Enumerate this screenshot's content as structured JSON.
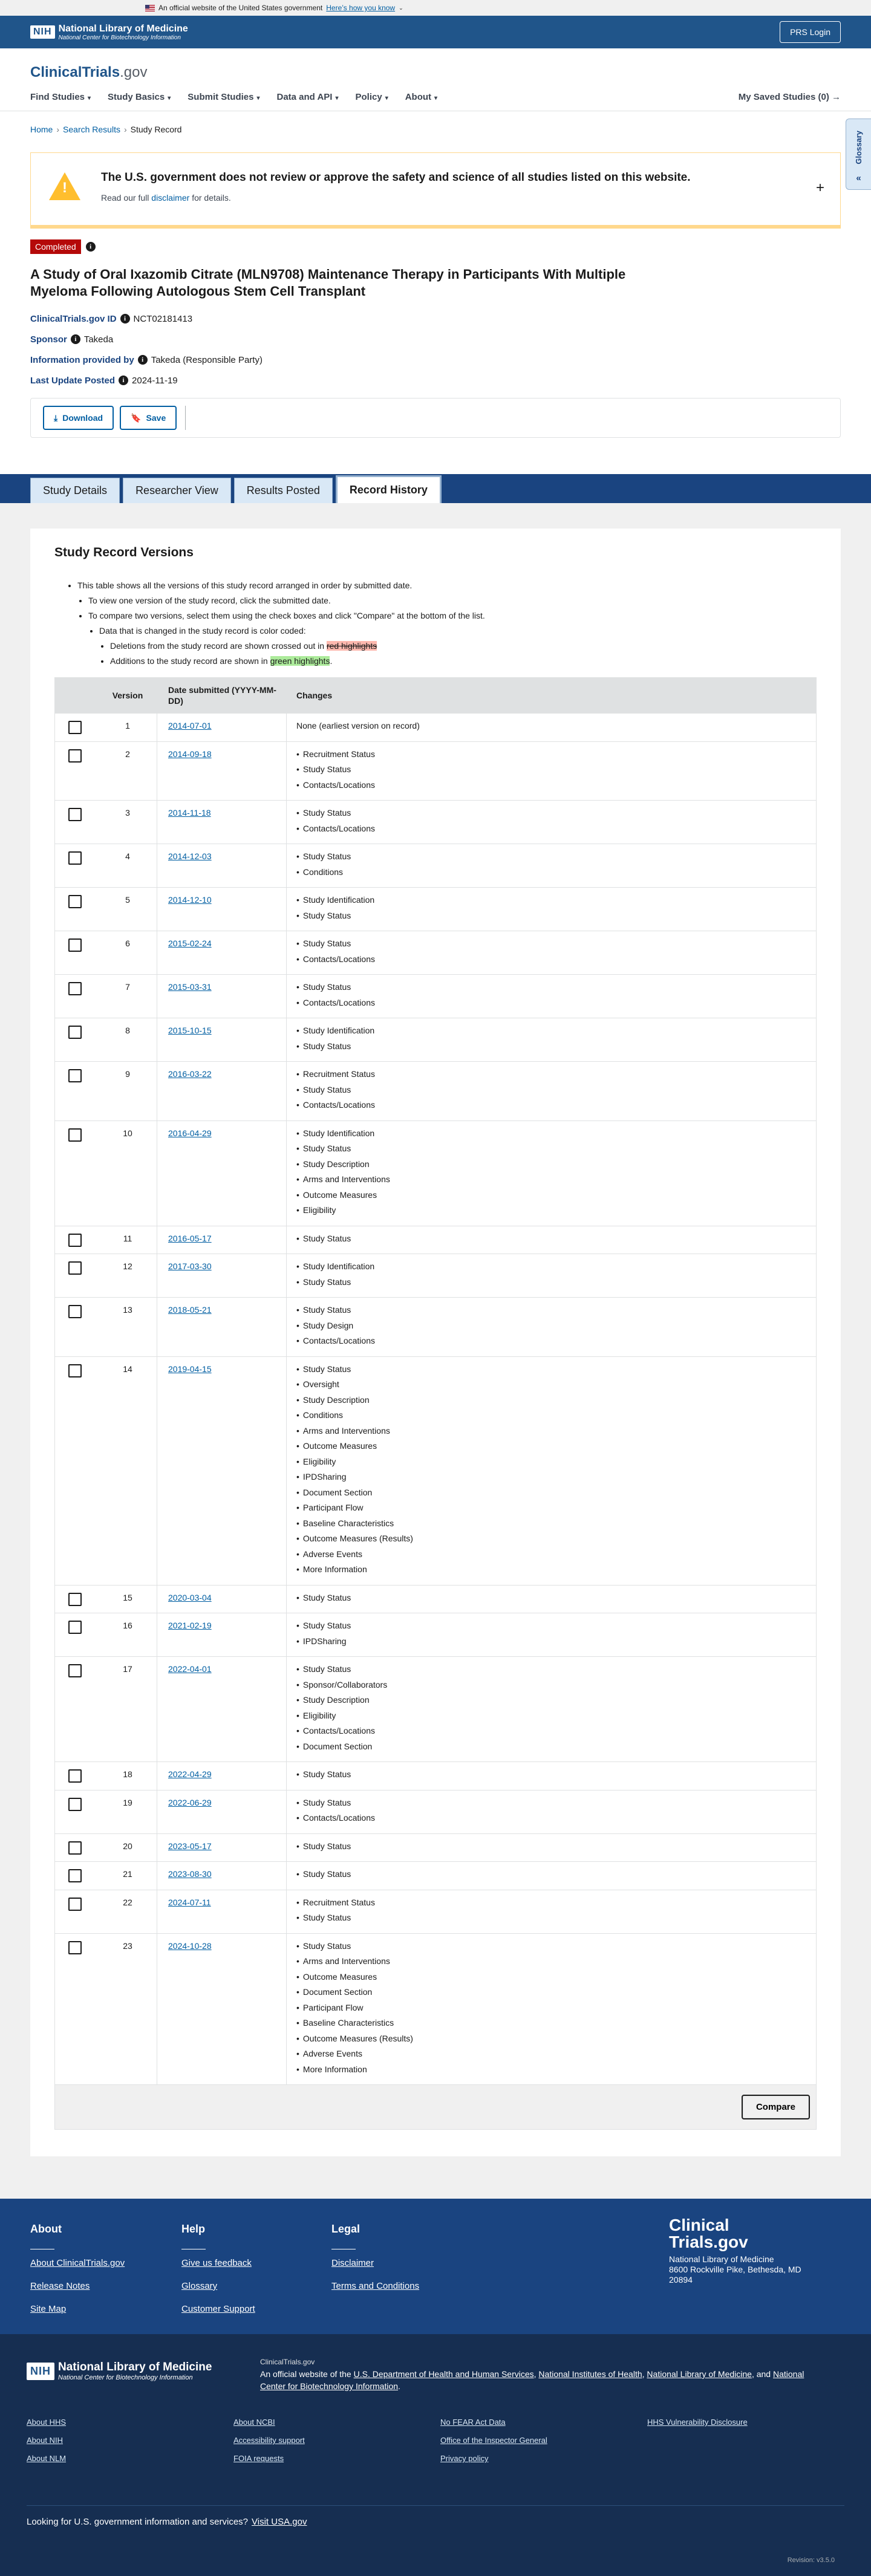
{
  "banner": {
    "text": "An official website of the United States government",
    "link": "Here’s how you know"
  },
  "nih": {
    "box": "NIH",
    "name": "National Library of Medicine",
    "sub": "National Center for Biotechnology Information",
    "prs": "PRS Login"
  },
  "header": {
    "logo_a": "ClinicalTrials",
    "logo_b": ".gov",
    "nav": [
      "Find Studies",
      "Study Basics",
      "Submit Studies",
      "Data and API",
      "Policy",
      "About"
    ],
    "saved": "My Saved Studies (0)",
    "glossary": "Glossary"
  },
  "breadcrumb": [
    "Home",
    "Search Results",
    "Study Record"
  ],
  "alert": {
    "title": "The U.S. government does not review or approve the safety and science of all studies listed on this website.",
    "pre": "Read our full",
    "link": "disclaimer",
    "post": "for details."
  },
  "study": {
    "status": "Completed",
    "title": "A Study of Oral Ixazomib Citrate (MLN9708) Maintenance Therapy in Participants With Multiple Myeloma Following Autologous Stem Cell Transplant",
    "id_label": "ClinicalTrials.gov ID",
    "id": "NCT02181413",
    "sponsor_label": "Sponsor",
    "sponsor": "Takeda",
    "info_label": "Information provided by",
    "info": "Takeda (Responsible Party)",
    "update_label": "Last Update Posted",
    "update": "2024-11-19"
  },
  "actions": {
    "download": "Download",
    "save": "Save"
  },
  "tabs": [
    "Study Details",
    "Researcher View",
    "Results Posted",
    "Record History"
  ],
  "history": {
    "heading": "Study Record Versions",
    "desc1": "This table shows all the versions of this study record arranged in order by submitted date.",
    "desc2": "To view one version of the study record, click the submitted date.",
    "desc3": "To compare two versions, select them using the check boxes and click \"Compare\" at the bottom of the list.",
    "desc4": "Data that is changed in the study record is color coded:",
    "desc5_pre": "Deletions from the study record are shown crossed out in",
    "desc5_hl": "red highlights",
    "desc6_pre": "Additions to the study record are shown in",
    "desc6_hl": "green highlights",
    "col_version": "Version",
    "col_date": "Date submitted (YYYY-MM-DD)",
    "col_changes": "Changes",
    "compare": "Compare",
    "versions": [
      {
        "v": "1",
        "date": "2014-07-01",
        "changes": [
          "None (earliest version on record)"
        ]
      },
      {
        "v": "2",
        "date": "2014-09-18",
        "changes": [
          "Recruitment Status",
          "Study Status",
          "Contacts/Locations"
        ]
      },
      {
        "v": "3",
        "date": "2014-11-18",
        "changes": [
          "Study Status",
          "Contacts/Locations"
        ]
      },
      {
        "v": "4",
        "date": "2014-12-03",
        "changes": [
          "Study Status",
          "Conditions"
        ]
      },
      {
        "v": "5",
        "date": "2014-12-10",
        "changes": [
          "Study Identification",
          "Study Status"
        ]
      },
      {
        "v": "6",
        "date": "2015-02-24",
        "changes": [
          "Study Status",
          "Contacts/Locations"
        ]
      },
      {
        "v": "7",
        "date": "2015-03-31",
        "changes": [
          "Study Status",
          "Contacts/Locations"
        ]
      },
      {
        "v": "8",
        "date": "2015-10-15",
        "changes": [
          "Study Identification",
          "Study Status"
        ]
      },
      {
        "v": "9",
        "date": "2016-03-22",
        "changes": [
          "Recruitment Status",
          "Study Status",
          "Contacts/Locations"
        ]
      },
      {
        "v": "10",
        "date": "2016-04-29",
        "changes": [
          "Study Identification",
          "Study Status",
          "Study Description",
          "Arms and Interventions",
          "Outcome Measures",
          "Eligibility"
        ]
      },
      {
        "v": "11",
        "date": "2016-05-17",
        "changes": [
          "Study Status"
        ]
      },
      {
        "v": "12",
        "date": "2017-03-30",
        "changes": [
          "Study Identification",
          "Study Status"
        ]
      },
      {
        "v": "13",
        "date": "2018-05-21",
        "changes": [
          "Study Status",
          "Study Design",
          "Contacts/Locations"
        ]
      },
      {
        "v": "14",
        "date": "2019-04-15",
        "changes": [
          "Study Status",
          "Oversight",
          "Study Description",
          "Conditions",
          "Arms and Interventions",
          "Outcome Measures",
          "Eligibility",
          "IPDSharing",
          "Document Section",
          "Participant Flow",
          "Baseline Characteristics",
          "Outcome Measures (Results)",
          "Adverse Events",
          "More Information"
        ]
      },
      {
        "v": "15",
        "date": "2020-03-04",
        "changes": [
          "Study Status"
        ]
      },
      {
        "v": "16",
        "date": "2021-02-19",
        "changes": [
          "Study Status",
          "IPDSharing"
        ]
      },
      {
        "v": "17",
        "date": "2022-04-01",
        "changes": [
          "Study Status",
          "Sponsor/Collaborators",
          "Study Description",
          "Eligibility",
          "Contacts/Locations",
          "Document Section"
        ]
      },
      {
        "v": "18",
        "date": "2022-04-29",
        "changes": [
          "Study Status"
        ]
      },
      {
        "v": "19",
        "date": "2022-06-29",
        "changes": [
          "Study Status",
          "Contacts/Locations"
        ]
      },
      {
        "v": "20",
        "date": "2023-05-17",
        "changes": [
          "Study Status"
        ]
      },
      {
        "v": "21",
        "date": "2023-08-30",
        "changes": [
          "Study Status"
        ]
      },
      {
        "v": "22",
        "date": "2024-07-11",
        "changes": [
          "Recruitment Status",
          "Study Status"
        ]
      },
      {
        "v": "23",
        "date": "2024-10-28",
        "changes": [
          "Study Status",
          "Arms and Interventions",
          "Outcome Measures",
          "Document Section",
          "Participant Flow",
          "Baseline Characteristics",
          "Outcome Measures (Results)",
          "Adverse Events",
          "More Information"
        ]
      }
    ]
  },
  "footer": {
    "about": {
      "title": "About",
      "links": [
        "About ClinicalTrials.gov",
        "Release Notes",
        "Site Map"
      ]
    },
    "help": {
      "title": "Help",
      "links": [
        "Give us feedback",
        "Glossary",
        "Customer Support"
      ]
    },
    "legal": {
      "title": "Legal",
      "links": [
        "Disclaimer",
        "Terms and Conditions"
      ]
    },
    "brand": {
      "name1": "Clinical",
      "name2": "Trials.gov",
      "addr1": "National Library of Medicine",
      "addr2": "8600 Rockville Pike, Bethesda, MD",
      "addr3": "20894"
    }
  },
  "subfooter": {
    "site": "ClinicalTrials.gov",
    "official_pre": "An official website of the",
    "hhs": "U.S. Department of Health and Human Services",
    "nih": "National Institutes of Health",
    "nlm": "National Library of Medicine",
    "and": "and",
    "ncbi": "National Center for Biotechnology Information",
    "links": [
      "About HHS",
      "About NIH",
      "About NLM",
      "About NCBI",
      "Accessibility support",
      "FOIA requests",
      "No FEAR Act Data",
      "Office of the Inspector General",
      "Privacy policy",
      "HHS Vulnerability Disclosure"
    ],
    "look": "Looking for U.S. government information and services?",
    "usa": "Visit USA.gov",
    "revision": "Revision: v3.5.0"
  }
}
